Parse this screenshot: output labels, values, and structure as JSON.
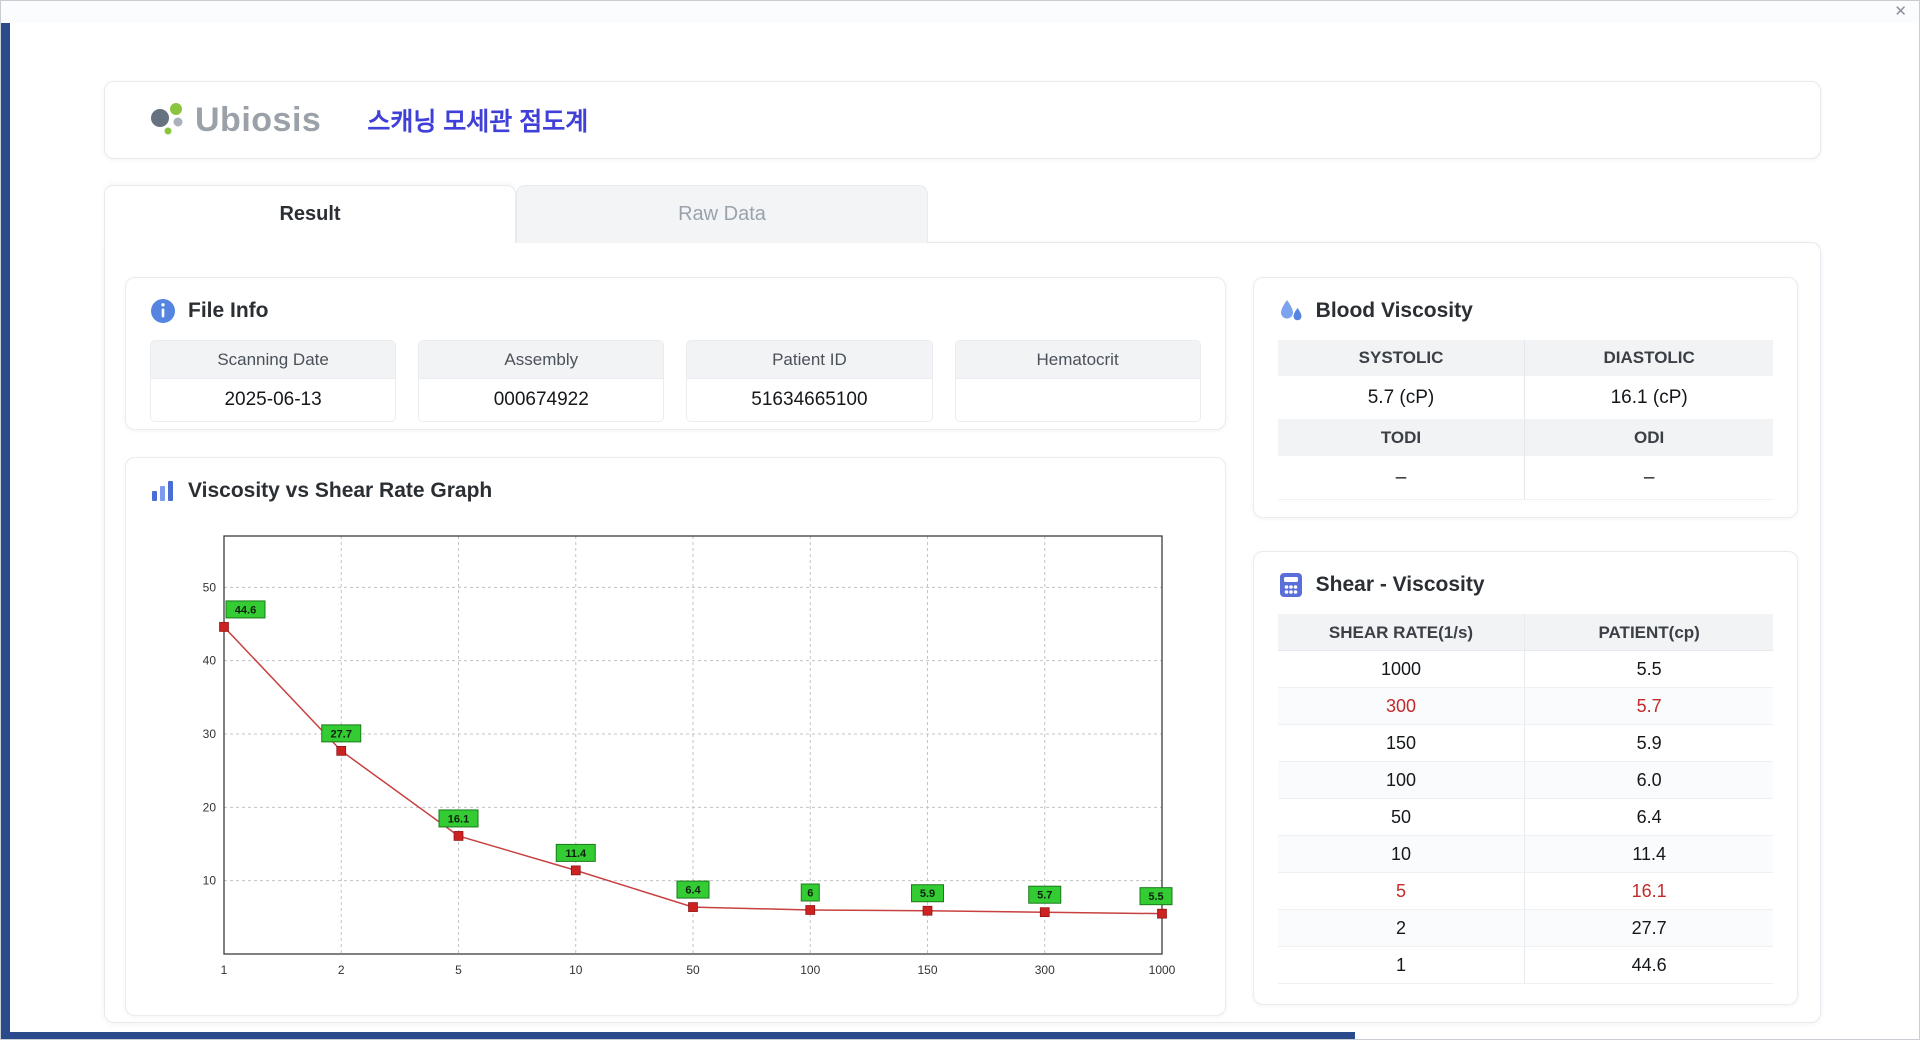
{
  "window": {
    "close_icon": "✕"
  },
  "header": {
    "logo_text": "Ubiosis",
    "title": "스캐닝 모세관 점도계"
  },
  "tabs": [
    {
      "label": "Result",
      "active": true
    },
    {
      "label": "Raw Data",
      "active": false
    }
  ],
  "file_info": {
    "title": "File Info",
    "fields": [
      {
        "label": "Scanning Date",
        "value": "2025-06-13"
      },
      {
        "label": "Assembly",
        "value": "000674922"
      },
      {
        "label": "Patient ID",
        "value": "51634665100"
      },
      {
        "label": "Hematocrit",
        "value": ""
      }
    ]
  },
  "graph": {
    "title": "Viscosity vs Shear Rate Graph"
  },
  "chart_data": {
    "type": "line",
    "title": "Viscosity vs Shear Rate Graph",
    "x_scale": "categorical (log-spaced shear rates)",
    "x_ticks": [
      "1",
      "2",
      "5",
      "10",
      "50",
      "100",
      "150",
      "300",
      "1000"
    ],
    "x": [
      1,
      2,
      5,
      10,
      50,
      100,
      150,
      300,
      1000
    ],
    "values": [
      44.6,
      27.7,
      16.1,
      11.4,
      6.4,
      6,
      5.9,
      5.7,
      5.5
    ],
    "labels": [
      "44.6",
      "27.7",
      "16.1",
      "11.4",
      "6.4",
      "6",
      "5.9",
      "5.7",
      "5.5"
    ],
    "y_ticks": [
      10,
      20,
      30,
      40,
      50
    ],
    "ylim": [
      0,
      57
    ],
    "xlabel": "",
    "ylabel": "",
    "grid": "dashed",
    "legend": "none",
    "line_color": "#c84040",
    "marker_color": "#cc2222",
    "label_bg": "#33cc33",
    "label_border": "#1b7a1b"
  },
  "blood_viscosity": {
    "title": "Blood Viscosity",
    "rows": [
      {
        "h1": "SYSTOLIC",
        "h2": "DIASTOLIC",
        "v1": "5.7 (cP)",
        "v2": "16.1 (cP)"
      },
      {
        "h1": "TODI",
        "h2": "ODI",
        "v1": "–",
        "v2": "–"
      }
    ]
  },
  "shear_viscosity": {
    "title": "Shear - Viscosity",
    "columns": [
      "SHEAR RATE(1/s)",
      "PATIENT(cp)"
    ],
    "rows": [
      {
        "rate": "1000",
        "patient": "5.5",
        "highlight": false
      },
      {
        "rate": "300",
        "patient": "5.7",
        "highlight": true
      },
      {
        "rate": "150",
        "patient": "5.9",
        "highlight": false
      },
      {
        "rate": "100",
        "patient": "6.0",
        "highlight": false
      },
      {
        "rate": "50",
        "patient": "6.4",
        "highlight": false
      },
      {
        "rate": "10",
        "patient": "11.4",
        "highlight": false
      },
      {
        "rate": "5",
        "patient": "16.1",
        "highlight": true
      },
      {
        "rate": "2",
        "patient": "27.7",
        "highlight": false
      },
      {
        "rate": "1",
        "patient": "44.6",
        "highlight": false
      }
    ]
  },
  "colors": {
    "accent_blue": "#4040d8",
    "strip_navy": "#2b4a8b",
    "highlight_red": "#c32a2a",
    "chart_label_green": "#33cc33",
    "chart_line_red": "#c84040"
  }
}
